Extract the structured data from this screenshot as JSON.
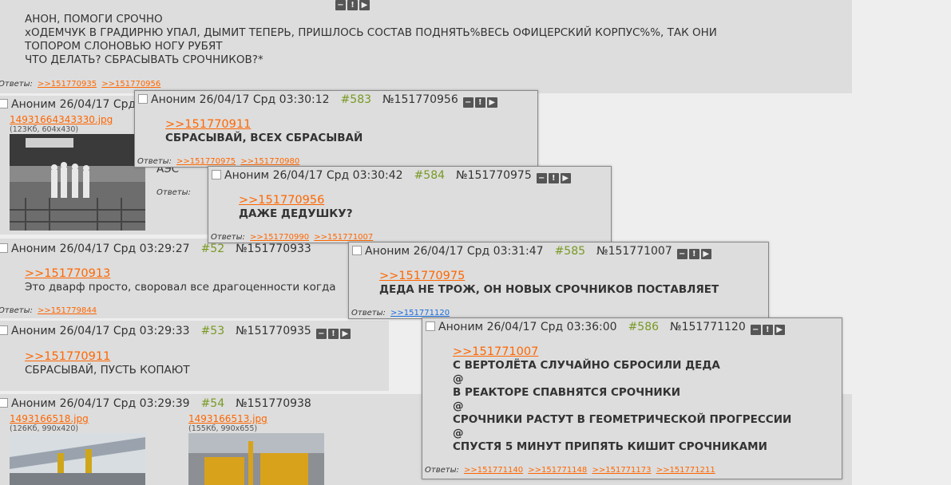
{
  "top_post": {
    "lines": [
      "АНОН, ПОМОГИ СРОЧНО",
      "хОДЕМЧУК В ГРАДИРНЮ УПАЛ, ДЫМИТ ТЕПЕРЬ, ПРИШЛОСЬ СОСТАВ ПОДНЯТЬ%ВЕСЬ ОФИЦЕРСКИЙ КОРПУС%%, ТАК ОНИ",
      "ТОПОРОМ СЛОНОВЬЮ НОГУ РУБЯТ",
      "ЧТО ДЕЛАТЬ? СБРАСЫВАТЬ СРОЧНИКОВ?*"
    ],
    "replies_label": "Ответы:",
    "replies": [
      ">>151770935",
      ">>151770956"
    ]
  },
  "post_52": {
    "author": "Аноним",
    "date": "26/04/17 Срд 03:29:27",
    "num": "#52",
    "id": "№151770933",
    "link": ">>151770913",
    "text": "Это дварф просто, своровал все драгоценности когда",
    "replies_label": "Ответы:",
    "replies": [
      ">>151779844"
    ]
  },
  "post_53": {
    "author": "Аноним",
    "date": "26/04/17 Срд 03:29:33",
    "num": "#53",
    "id": "№151770935",
    "link": ">>151770911",
    "text": "СБРАСЫВАЙ, ПУСТЬ КОПАЮТ"
  },
  "post_54": {
    "author": "Аноним",
    "date": "26/04/17 Срд 03:29:39",
    "num": "#54",
    "id": "№151770938",
    "files": [
      {
        "name": "1493166518.jpg",
        "meta": "(126Кб, 990x420)"
      },
      {
        "name": "1493166513.jpg",
        "meta": "(155Кб, 990x655)"
      }
    ]
  },
  "post_img": {
    "author": "Аноним",
    "date": "26/04/17 Срд",
    "file": {
      "name": "14931664343330.jpg",
      "meta": "(123Кб, 604x430)"
    },
    "text": "АЭС",
    "replies_label": "Ответы:"
  },
  "popup_583": {
    "author": "Аноним",
    "date": "26/04/17 Срд 03:30:12",
    "num": "#583",
    "id": "№151770956",
    "link": ">>151770911",
    "text": "СБРАСЫВАЙ, ВСЕХ СБРАСЫВАЙ",
    "replies_label": "Ответы:",
    "replies": [
      ">>151770975",
      ">>151770980"
    ]
  },
  "popup_584": {
    "author": "Аноним",
    "date": "26/04/17 Срд 03:30:42",
    "num": "#584",
    "id": "№151770975",
    "link": ">>151770956",
    "text": "ДАЖЕ ДЕДУШКУ?",
    "replies_label": "Ответы:",
    "replies": [
      ">>151770990",
      ">>151771007"
    ]
  },
  "popup_585": {
    "author": "Аноним",
    "date": "26/04/17 Срд 03:31:47",
    "num": "#585",
    "id": "№151771007",
    "link": ">>151770975",
    "text": "ДЕДА НЕ ТРОЖ, ОН НОВЫХ СРОЧНИКОВ ПОСТАВЛЯЕТ",
    "replies_label": "Ответы:",
    "replies": [
      ">>151771120"
    ]
  },
  "popup_586": {
    "author": "Аноним",
    "date": "26/04/17 Срд 03:36:00",
    "num": "#586",
    "id": "№151771120",
    "link": ">>151771007",
    "lines": [
      "С ВЕРТОЛЁТА СЛУЧАЙНО СБРОСИЛИ ДЕДА",
      "@",
      "В РЕАКТОРЕ СПАВНЯТСЯ СРОЧНИКИ",
      "@",
      "СРОЧНИКИ РАСТУТ В ГЕОМЕТРИЧЕСКОЙ ПРОГРЕССИИ",
      "@",
      "СПУСТЯ 5 МИНУТ ПРИПЯТЬ КИШИТ СРОЧНИКАМИ"
    ],
    "replies_label": "Ответы:",
    "replies": [
      ">>151771140",
      ">>151771148",
      ">>151771173",
      ">>151771211"
    ]
  },
  "buttons": {
    "hide": "−",
    "report": "!",
    "play": "▶"
  },
  "colors": {
    "link": "#ff6600",
    "post_num": "#789922",
    "post_bg": "#dddddd",
    "page_bg": "#eeeeee",
    "visited_link": "#1a6ee0"
  }
}
